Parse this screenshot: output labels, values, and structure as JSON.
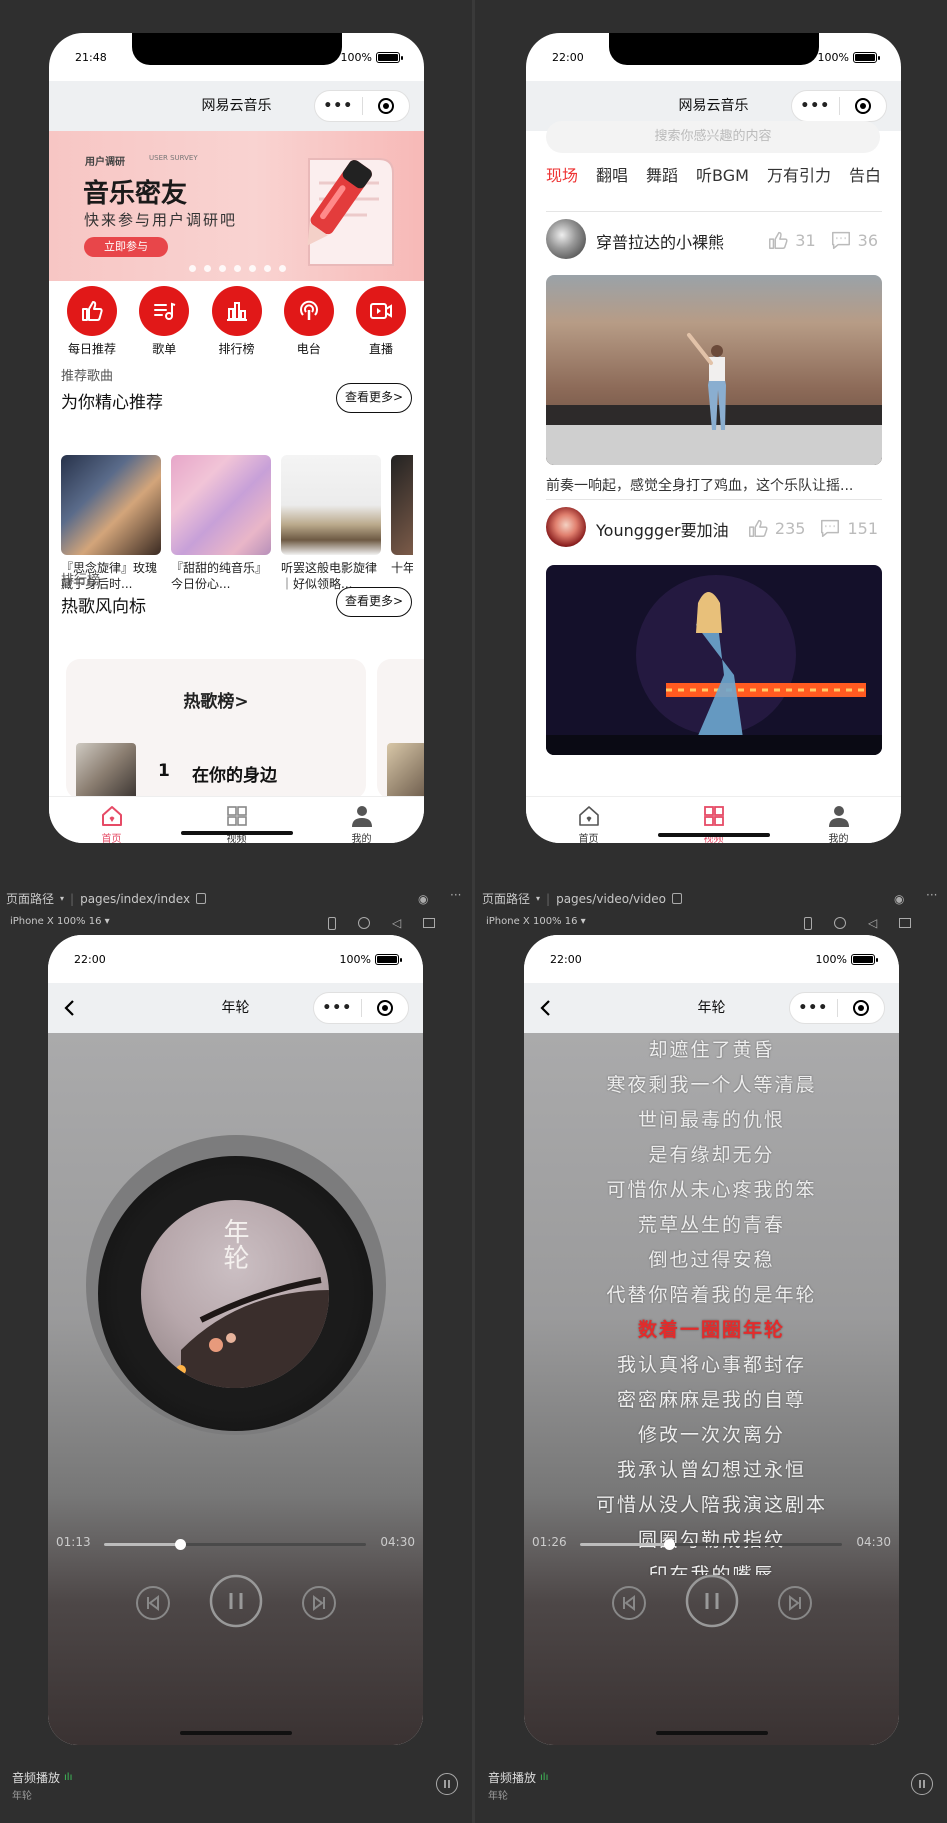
{
  "colors": {
    "accent_red": "#e11818",
    "tab_active_pink": "#e64b66",
    "lyric_highlight": "#e32b2b"
  },
  "panel_home": {
    "status": {
      "time": "21:48",
      "battery": "100%"
    },
    "nav_title": "网易云音乐",
    "banner": {
      "tag": "用户调研",
      "tag_en": "USER SURVEY",
      "title": "音乐密友",
      "subtitle": "快来参与用户调研吧",
      "button": "立即参与",
      "page_count": 7
    },
    "quick_icons": [
      {
        "label": "每日推荐",
        "icon": "thumbs-up-icon"
      },
      {
        "label": "歌单",
        "icon": "playlist-icon"
      },
      {
        "label": "排行榜",
        "icon": "chart-icon"
      },
      {
        "label": "电台",
        "icon": "radio-icon"
      },
      {
        "label": "直播",
        "icon": "live-video-icon"
      }
    ],
    "recommend": {
      "small": "推荐歌曲",
      "title": "为你精心推荐",
      "more": "查看更多>"
    },
    "rec_cards": [
      {
        "text": "『思念旋律』玫瑰藏于身后时..."
      },
      {
        "text": "『甜甜的纯音乐』今日份心..."
      },
      {
        "text": "听罢这般电影旋律｜好似领略..."
      },
      {
        "text": "十年在，"
      }
    ],
    "ranking": {
      "small": "排行榜",
      "title": "热歌风向标",
      "more": "查看更多>",
      "card_title": "热歌榜>",
      "first_num": "1",
      "first_song": "在你的身边"
    },
    "tabbar": [
      {
        "label": "首页",
        "icon": "home-icon",
        "active": true
      },
      {
        "label": "视频",
        "icon": "grid-icon",
        "active": false
      },
      {
        "label": "我的",
        "icon": "user-icon",
        "active": false
      }
    ]
  },
  "panel_video": {
    "status": {
      "time": "22:00",
      "battery": "100%"
    },
    "nav_title": "网易云音乐",
    "search_placeholder": "搜索你感兴趣的内容",
    "tabs": [
      "现场",
      "翻唱",
      "舞蹈",
      "听BGM",
      "万有引力",
      "告白"
    ],
    "videos": [
      {
        "author": "穿普拉达的小裸熊",
        "likes": "31",
        "comments": "36",
        "desc": "前奏一响起，感觉全身打了鸡血，这个乐队让摇..."
      },
      {
        "author": "Younggger要加油",
        "likes": "235",
        "comments": "151"
      }
    ],
    "tabbar": [
      {
        "label": "首页",
        "icon": "home-icon",
        "active": false
      },
      {
        "label": "视频",
        "icon": "grid-icon",
        "active": true
      },
      {
        "label": "我的",
        "icon": "user-icon",
        "active": false
      }
    ]
  },
  "devtools_left": {
    "path_label": "页面路径",
    "path": "pages/index/index",
    "device": "iPhone X 100% 16"
  },
  "devtools_right": {
    "path_label": "页面路径",
    "path": "pages/video/video",
    "device": "iPhone X 100% 16"
  },
  "panel_player": {
    "status": {
      "time": "22:00",
      "battery": "100%"
    },
    "nav_title": "年轮",
    "cover_text": "年轮",
    "current_time": "01:13",
    "total_time": "04:30",
    "progress_fraction": 0.29
  },
  "panel_lyrics": {
    "status": {
      "time": "22:00",
      "battery": "100%"
    },
    "nav_title": "年轮",
    "lines": [
      "却遮住了黄昏",
      "寒夜剩我一个人等清晨",
      "世间最毒的仇恨",
      "是有缘却无分",
      "可惜你从未心疼我的笨",
      "荒草丛生的青春",
      "倒也过得安稳",
      "代替你陪着我的是年轮",
      "数着一圈圈年轮",
      "我认真将心事都封存",
      "密密麻麻是我的自尊",
      "修改一次次离分",
      "我承认曾幻想过永恒",
      "可惜从没人陪我演这剧本",
      "圆圈勾勒成指纹",
      "印在我的嘴唇"
    ],
    "current_index": 8,
    "current_time": "01:26",
    "total_time": "04:30",
    "progress_fraction": 0.34
  },
  "audio_bar": {
    "title": "音频播放",
    "song": "年轮"
  }
}
